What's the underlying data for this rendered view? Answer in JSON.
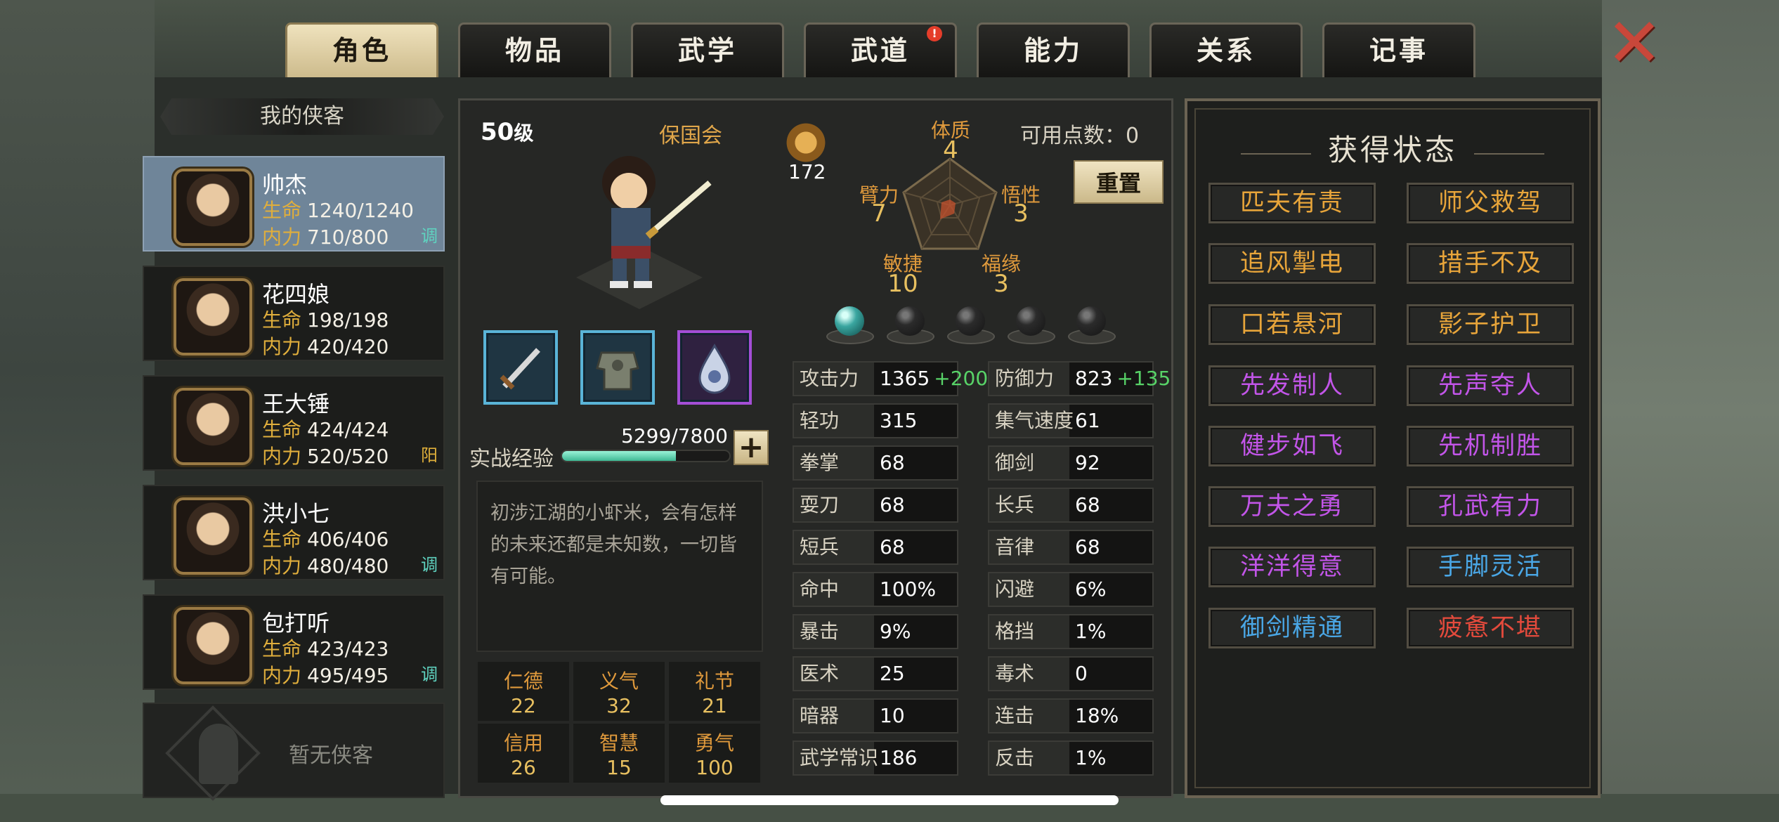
{
  "tabs": [
    {
      "label": "角色"
    },
    {
      "label": "物品"
    },
    {
      "label": "武学"
    },
    {
      "label": "武道",
      "badge": "!"
    },
    {
      "label": "能力"
    },
    {
      "label": "关系"
    },
    {
      "label": "记事"
    }
  ],
  "close_icon": "close-x-icon",
  "hero_list": {
    "title": "我的侠客",
    "empty_label": "暂无侠客",
    "heroes": [
      {
        "name": "帅杰",
        "hp_label": "生命",
        "hp": "1240/1240",
        "mp_label": "内力",
        "mp": "710/800",
        "tag": "调",
        "tag_color": "#5fd3c0"
      },
      {
        "name": "花四娘",
        "hp_label": "生命",
        "hp": "198/198",
        "mp_label": "内力",
        "mp": "420/420",
        "tag": "",
        "tag_color": ""
      },
      {
        "name": "王大锤",
        "hp_label": "生命",
        "hp": "424/424",
        "mp_label": "内力",
        "mp": "520/520",
        "tag": "阳",
        "tag_color": "#e0b03a"
      },
      {
        "name": "洪小七",
        "hp_label": "生命",
        "hp": "406/406",
        "mp_label": "内力",
        "mp": "480/480",
        "tag": "调",
        "tag_color": "#5fd3c0"
      },
      {
        "name": "包打听",
        "hp_label": "生命",
        "hp": "423/423",
        "mp_label": "内力",
        "mp": "495/495",
        "tag": "调",
        "tag_color": "#5fd3c0"
      }
    ]
  },
  "character": {
    "level": "50",
    "level_unit": "级",
    "faction": "保国会",
    "sword_count": "172",
    "attributes": {
      "tizhi": {
        "label": "体质",
        "value": "4"
      },
      "bili": {
        "label": "臂力",
        "value": "7"
      },
      "wuxing": {
        "label": "悟性",
        "value": "3"
      },
      "minjie": {
        "label": "敏捷",
        "value": "10"
      },
      "fuyuan": {
        "label": "福缘",
        "value": "3"
      }
    },
    "points_label": "可用点数：0",
    "reset_label": "重置",
    "exp_label": "实战经验",
    "exp_value": "5299/7800",
    "exp_fraction": 0.679,
    "plus_label": "+",
    "description": "初涉江湖的小虾米，会有怎样的未来还都是未知数，一切皆有可能。",
    "virtues": [
      {
        "label": "仁德",
        "value": "22"
      },
      {
        "label": "义气",
        "value": "32"
      },
      {
        "label": "礼节",
        "value": "21"
      },
      {
        "label": "信用",
        "value": "26"
      },
      {
        "label": "智慧",
        "value": "15"
      },
      {
        "label": "勇气",
        "value": "100"
      }
    ],
    "equipment": [
      "sword-icon",
      "armor-icon",
      "accessory-icon"
    ],
    "gems": [
      "teal",
      "empty",
      "empty",
      "empty",
      "empty"
    ]
  },
  "stats": {
    "left": [
      {
        "label": "攻击力",
        "value": "1365",
        "bonus": "+200"
      },
      {
        "label": "轻功",
        "value": "315"
      },
      {
        "label": "拳掌",
        "value": "68"
      },
      {
        "label": "耍刀",
        "value": "68"
      },
      {
        "label": "短兵",
        "value": "68"
      },
      {
        "label": "命中",
        "value": "100%"
      },
      {
        "label": "暴击",
        "value": "9%"
      },
      {
        "label": "医术",
        "value": "25"
      },
      {
        "label": "暗器",
        "value": "10"
      },
      {
        "label": "武学常识",
        "value": "186"
      }
    ],
    "right": [
      {
        "label": "防御力",
        "value": "823",
        "bonus": "+135"
      },
      {
        "label": "集气速度",
        "value": "61"
      },
      {
        "label": "御剑",
        "value": "92"
      },
      {
        "label": "长兵",
        "value": "68"
      },
      {
        "label": "音律",
        "value": "68"
      },
      {
        "label": "闪避",
        "value": "6%"
      },
      {
        "label": "格挡",
        "value": "1%"
      },
      {
        "label": "毒术",
        "value": "0"
      },
      {
        "label": "连击",
        "value": "18%"
      },
      {
        "label": "反击",
        "value": "1%"
      }
    ]
  },
  "status_panel": {
    "title": "获得状态",
    "items": [
      {
        "label": "匹夫有责",
        "color": "gold"
      },
      {
        "label": "师父救驾",
        "color": "gold"
      },
      {
        "label": "追风掣电",
        "color": "gold"
      },
      {
        "label": "措手不及",
        "color": "gold"
      },
      {
        "label": "口若悬河",
        "color": "gold"
      },
      {
        "label": "影子护卫",
        "color": "gold"
      },
      {
        "label": "先发制人",
        "color": "purple"
      },
      {
        "label": "先声夺人",
        "color": "purple"
      },
      {
        "label": "健步如飞",
        "color": "purple"
      },
      {
        "label": "先机制胜",
        "color": "purple"
      },
      {
        "label": "万夫之勇",
        "color": "purple"
      },
      {
        "label": "孔武有力",
        "color": "purple"
      },
      {
        "label": "洋洋得意",
        "color": "purple"
      },
      {
        "label": "手脚灵活",
        "color": "blue"
      },
      {
        "label": "御剑精通",
        "color": "blue"
      },
      {
        "label": "疲惫不堪",
        "color": "red"
      }
    ]
  }
}
